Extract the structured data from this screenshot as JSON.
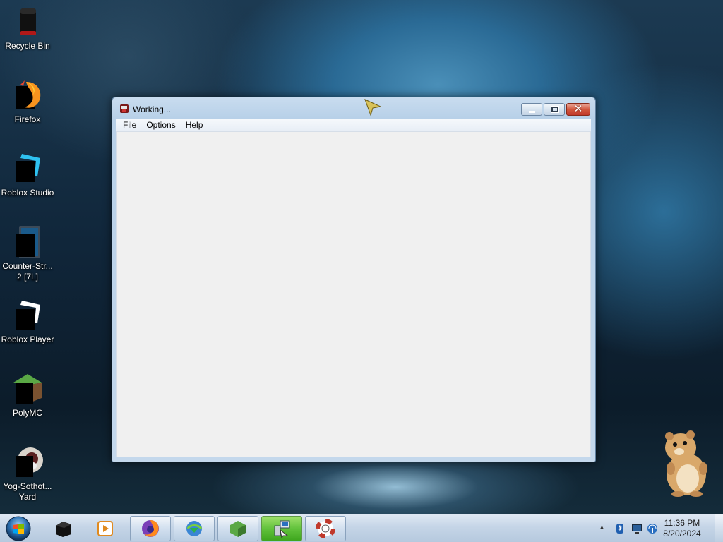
{
  "desktop": {
    "icons": [
      {
        "label": "Recycle Bin",
        "icon": "recycle-bin-icon"
      },
      {
        "label": "Firefox",
        "icon": "firefox-icon"
      },
      {
        "label": "Roblox Studio",
        "icon": "roblox-studio-icon"
      },
      {
        "label": "Counter-Str...\n2 [7L]",
        "icon": "counter-strike-icon"
      },
      {
        "label": "Roblox Player",
        "icon": "roblox-player-icon"
      },
      {
        "label": "PolyMC",
        "icon": "polymc-icon"
      },
      {
        "label": "Yog-Sothot...\nYard",
        "icon": "yog-sothoth-icon"
      }
    ]
  },
  "window": {
    "title": "Working...",
    "icon": "app-window-icon",
    "menu": [
      "File",
      "Options",
      "Help"
    ],
    "buttons": {
      "minimize": "minimize-icon",
      "maximize": "maximize-icon",
      "close": "close-icon"
    }
  },
  "taskbar": {
    "start": "windows-start-icon",
    "buttons": [
      {
        "icon": "black-box-app-icon",
        "state": "pinned-idle"
      },
      {
        "icon": "media-player-icon",
        "state": "pinned-idle"
      },
      {
        "icon": "firefox-icon",
        "state": "pinned"
      },
      {
        "icon": "download-manager-icon",
        "state": "pinned"
      },
      {
        "icon": "polymc-icon",
        "state": "pinned"
      },
      {
        "icon": "network-computer-icon",
        "state": "active"
      },
      {
        "icon": "lifebuoy-icon",
        "state": "pinned"
      }
    ],
    "tray": {
      "icons": [
        "show-hidden-icons-arrow",
        "bluetooth-icon",
        "monitor-icon",
        "network-icon"
      ],
      "time": "11:36 PM",
      "date": "8/20/2024"
    }
  },
  "colors": {
    "window_frame": "#c4d8ec",
    "client_background": "#f0f0f0",
    "close_button": "#c0392b",
    "active_task": "#62c23c"
  }
}
